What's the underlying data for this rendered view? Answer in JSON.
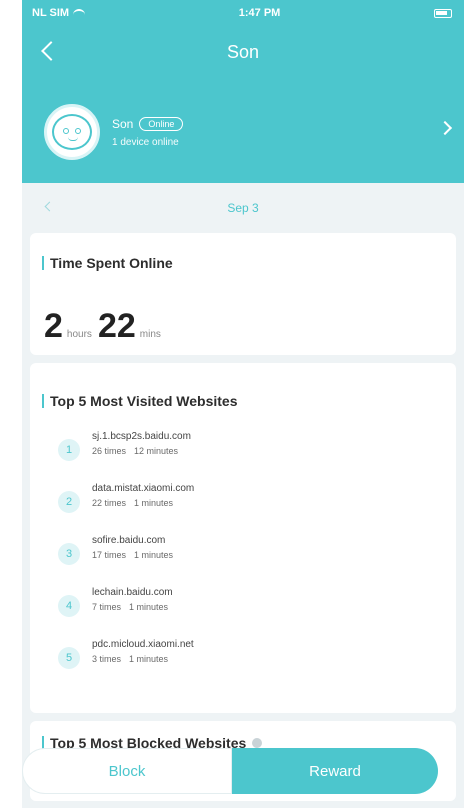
{
  "status_bar": {
    "carrier": "NL SIM",
    "time": "1:47 PM"
  },
  "header": {
    "title": "Son"
  },
  "profile": {
    "name": "Son",
    "status": "Online",
    "devices": "1 device online"
  },
  "date": {
    "label": "Sep 3"
  },
  "time_spent": {
    "title": "Time Spent Online",
    "hours": "2",
    "hours_unit": "hours",
    "minutes": "22",
    "minutes_unit": "mins"
  },
  "top_visited": {
    "title": "Top 5 Most Visited Websites",
    "items": [
      {
        "rank": "1",
        "url": "sj.1.bcsp2s.baidu.com",
        "times": "26 times",
        "minutes": "12 minutes"
      },
      {
        "rank": "2",
        "url": "data.mistat.xiaomi.com",
        "times": "22 times",
        "minutes": "1 minutes"
      },
      {
        "rank": "3",
        "url": "sofire.baidu.com",
        "times": "17 times",
        "minutes": "1 minutes"
      },
      {
        "rank": "4",
        "url": "lechain.baidu.com",
        "times": "7 times",
        "minutes": "1 minutes"
      },
      {
        "rank": "5",
        "url": "pdc.micloud.xiaomi.net",
        "times": "3 times",
        "minutes": "1 minutes"
      }
    ]
  },
  "top_blocked": {
    "title": "Top 5 Most Blocked Websites"
  },
  "actions": {
    "block": "Block",
    "reward": "Reward"
  },
  "colors": {
    "accent": "#4cc6cd",
    "background": "#eef3f5"
  }
}
